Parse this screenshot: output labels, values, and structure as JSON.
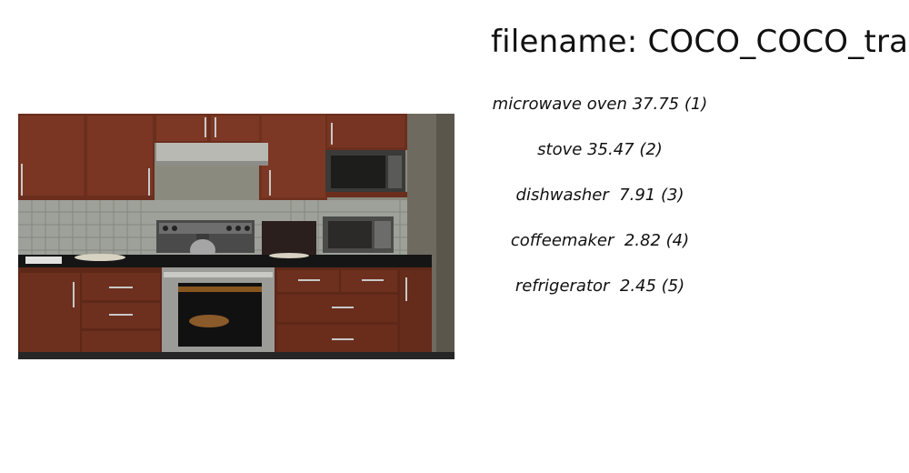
{
  "title": "filename: COCO_COCO_train",
  "predictions": [
    {
      "text": "microwave oven 37.75 (1)"
    },
    {
      "text": "stove 35.47 (2)"
    },
    {
      "text": "dishwasher  7.91 (3)"
    },
    {
      "text": "coffeemaker  2.82 (4)"
    },
    {
      "text": "refrigerator  2.45 (5)"
    }
  ]
}
